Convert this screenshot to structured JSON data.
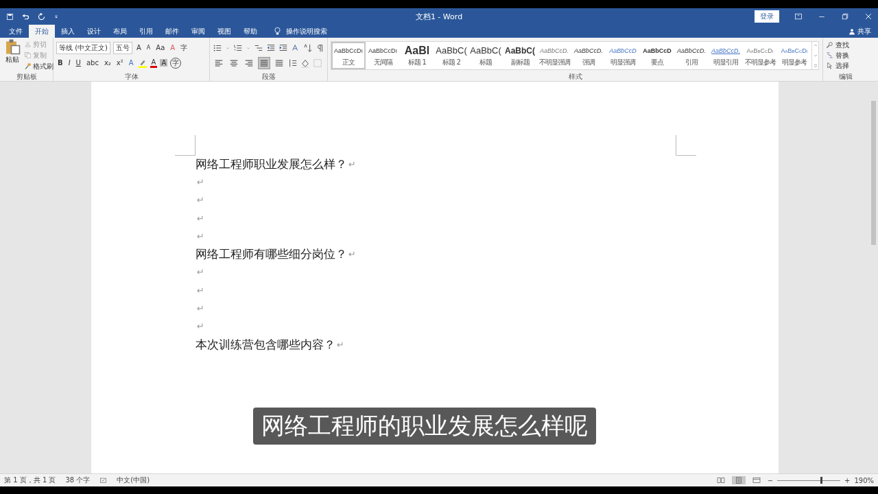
{
  "window": {
    "title": "文档1  -  Word",
    "login": "登录",
    "share": "共享"
  },
  "tabs": [
    {
      "label": "文件",
      "selected": false
    },
    {
      "label": "开始",
      "selected": true
    },
    {
      "label": "插入",
      "selected": false
    },
    {
      "label": "设计",
      "selected": false
    },
    {
      "label": "布局",
      "selected": false
    },
    {
      "label": "引用",
      "selected": false
    },
    {
      "label": "邮件",
      "selected": false
    },
    {
      "label": "审阅",
      "selected": false
    },
    {
      "label": "视图",
      "selected": false
    },
    {
      "label": "帮助",
      "selected": false
    }
  ],
  "tell_me": "操作说明搜索",
  "clipboard": {
    "paste": "粘贴",
    "cut": "剪切",
    "copy": "复制",
    "format_painter": "格式刷",
    "label": "剪贴板"
  },
  "font": {
    "font_name": "等线 (中文正文)",
    "font_size": "五号",
    "grow": "A",
    "shrink": "A",
    "change_case": "Aa",
    "clear": "A",
    "format_buttons": [
      "B",
      "I",
      "U",
      "abc",
      "x₂",
      "x²"
    ],
    "effects": "A",
    "font_color": "A",
    "shade": "A",
    "enclose": "字",
    "phonetic": "字",
    "label": "字体"
  },
  "paragraph": {
    "alignments": [
      {
        "kind": "left",
        "selected": false
      },
      {
        "kind": "center",
        "selected": false
      },
      {
        "kind": "right",
        "selected": false
      },
      {
        "kind": "justify",
        "selected": true
      },
      {
        "kind": "distributed",
        "selected": false
      }
    ],
    "label": "段落"
  },
  "styles": {
    "items": [
      {
        "preview": "AaBbCcDı",
        "label": "正文",
        "kind": "normal",
        "selected": true
      },
      {
        "preview": "AaBbCcDı",
        "label": "无间隔",
        "kind": "normal",
        "selected": false
      },
      {
        "preview": "AaBl",
        "label": "标题 1",
        "kind": "heading1",
        "selected": false
      },
      {
        "preview": "AaBbC(",
        "label": "标题 2",
        "kind": "heading2",
        "selected": false
      },
      {
        "preview": "AaBbC(",
        "label": "标题",
        "kind": "title",
        "selected": false
      },
      {
        "preview": "AaBbC(",
        "label": "副标题",
        "kind": "subtitle",
        "selected": false
      },
      {
        "preview": "AaBbCcD.",
        "label": "不明显强调",
        "kind": "subtle",
        "selected": false
      },
      {
        "preview": "AaBbCcD.",
        "label": "强调",
        "kind": "emphasis",
        "selected": false
      },
      {
        "preview": "AaBbCcD",
        "label": "明显强调",
        "kind": "intense",
        "selected": false
      },
      {
        "preview": "AaBbCcD",
        "label": "要点",
        "kind": "strong",
        "selected": false
      },
      {
        "preview": "AaBbCcD.",
        "label": "引用",
        "kind": "emphasis",
        "selected": false
      },
      {
        "preview": "AaBbCcD.",
        "label": "明显引用",
        "kind": "quote",
        "selected": false
      },
      {
        "preview": "AaBbCcDı",
        "label": "不明显参考",
        "kind": "subtle_ref",
        "selected": false
      },
      {
        "preview": "AaBbCcDı",
        "label": "明显参考",
        "kind": "intense_ref",
        "selected": false
      }
    ],
    "label": "样式"
  },
  "editing": {
    "find": "查找",
    "replace": "替换",
    "select": "选择",
    "label": "编辑"
  },
  "document": {
    "paragraphs": [
      {
        "text": "网络工程师职业发展怎么样？",
        "mark": "↵"
      },
      {
        "mark": "↵"
      },
      {
        "mark": "↵"
      },
      {
        "mark": "↵"
      },
      {
        "mark": "↵"
      },
      {
        "text": "网络工程师有哪些细分岗位？",
        "mark": "↵"
      },
      {
        "mark": "↵"
      },
      {
        "mark": "↵"
      },
      {
        "mark": "↵"
      },
      {
        "mark": "↵"
      },
      {
        "text": "本次训练营包含哪些内容？",
        "mark": "↵"
      }
    ]
  },
  "caption": "网络工程师的职业发展怎么样呢",
  "status_bar": {
    "page": "第 1 页，共 1 页",
    "words": "38 个字",
    "language": "中文(中国)",
    "views": [
      {
        "kind": "read",
        "selected": false
      },
      {
        "kind": "print",
        "selected": true
      },
      {
        "kind": "web",
        "selected": false
      }
    ],
    "zoom_out": "−",
    "zoom_in": "+",
    "zoom": {
      "level": 0.7
    },
    "zoom_label": "190%"
  }
}
